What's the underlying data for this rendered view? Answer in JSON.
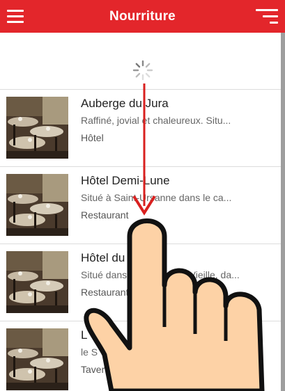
{
  "header": {
    "title": "Nourriture",
    "menu_icon": "hamburger-menu-icon",
    "filter_icon": "filter-icon"
  },
  "colors": {
    "header_bg": "#e3262b",
    "gesture_arrow": "#d9201f",
    "hand_fill": "#fdd2a6"
  },
  "refresh": {
    "icon": "loading-spinner-icon"
  },
  "list": {
    "items": [
      {
        "title": "Auberge du Jura",
        "desc": "Raffiné, jovial et chaleureux. Situ...",
        "type": "Hôtel"
      },
      {
        "title": "Hôtel Demi-Lune",
        "desc": "Situé à Saint-Ursanne dans le ca...",
        "type": "Restaurant"
      },
      {
        "title": "Hôtel du",
        "desc": "Situé dans le quartier de Vieille, da...",
        "type": "Restaurant"
      },
      {
        "title": "L",
        "desc": "le S",
        "type": "Taver"
      }
    ]
  },
  "gesture": {
    "icon": "swipe-down-hand-icon",
    "direction": "down"
  }
}
